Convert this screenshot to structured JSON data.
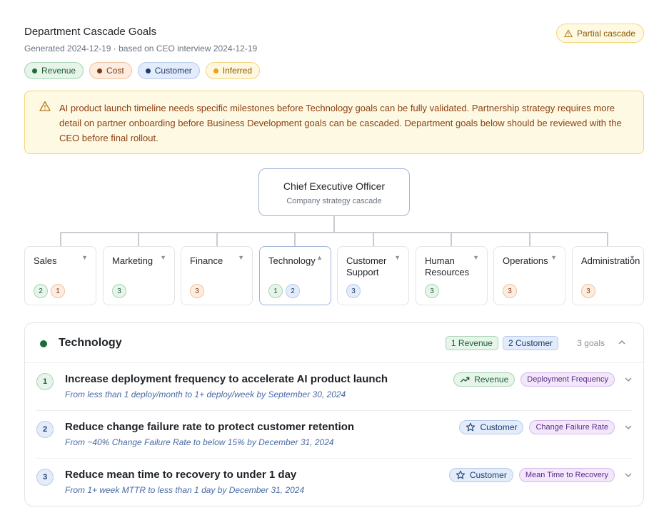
{
  "header": {
    "title": "Department Cascade Goals",
    "subtitle": "Generated 2024-12-19 · based on CEO interview 2024-12-19",
    "status_badge": "Partial cascade"
  },
  "legend": [
    {
      "label": "Revenue",
      "kind": "revenue"
    },
    {
      "label": "Cost",
      "kind": "cost"
    },
    {
      "label": "Customer",
      "kind": "customer"
    },
    {
      "label": "Inferred",
      "kind": "inferred"
    }
  ],
  "alert": {
    "text": "AI product launch timeline needs specific milestones before Technology goals can be fully validated. Partnership strategy requires more detail on partner onboarding before Business Development goals can be cascaded. Department goals below should be reviewed with the CEO before final rollout."
  },
  "ceo": {
    "name": "Chief Executive Officer",
    "desc": "Company strategy cascade"
  },
  "departments": [
    {
      "name": "Sales",
      "caret": "▼",
      "counts": [
        {
          "n": "2",
          "kind": "revenue"
        },
        {
          "n": "1",
          "kind": "cost"
        }
      ]
    },
    {
      "name": "Marketing",
      "caret": "▼",
      "counts": [
        {
          "n": "3",
          "kind": "revenue"
        }
      ]
    },
    {
      "name": "Finance",
      "caret": "▼",
      "counts": [
        {
          "n": "3",
          "kind": "cost"
        }
      ]
    },
    {
      "name": "Technology",
      "caret": "▲",
      "counts": [
        {
          "n": "1",
          "kind": "revenue"
        },
        {
          "n": "2",
          "kind": "customer"
        }
      ]
    },
    {
      "name": "Customer Support",
      "caret": "▼",
      "counts": [
        {
          "n": "3",
          "kind": "customer"
        }
      ]
    },
    {
      "name": "Human Resources",
      "caret": "▼",
      "counts": [
        {
          "n": "3",
          "kind": "revenue"
        }
      ]
    },
    {
      "name": "Operations",
      "caret": "▼",
      "counts": [
        {
          "n": "3",
          "kind": "cost"
        }
      ]
    },
    {
      "name": "Administration",
      "caret": "▼",
      "counts": [
        {
          "n": "3",
          "kind": "cost"
        }
      ]
    }
  ],
  "panel": {
    "title": "Technology",
    "tags": [
      {
        "label": "1 Revenue",
        "kind": "revenue"
      },
      {
        "label": "2 Customer",
        "kind": "customer"
      }
    ],
    "goal_count": "3 goals",
    "goals": [
      {
        "num": "1",
        "kind": "revenue",
        "title": "Increase deployment frequency to accelerate AI product launch",
        "sub": "From less than 1 deploy/month to 1+ deploy/week by September 30, 2024",
        "perspective": "Revenue",
        "icon": "trending-up-icon",
        "metric": "Deployment Frequency"
      },
      {
        "num": "2",
        "kind": "customer",
        "title": "Reduce change failure rate to protect customer retention",
        "sub": "From ~40% Change Failure Rate to below 15% by December 31, 2024",
        "perspective": "Customer",
        "icon": "star-icon",
        "metric": "Change Failure Rate"
      },
      {
        "num": "3",
        "kind": "customer",
        "title": "Reduce mean time to recovery to under 1 day",
        "sub": "From 1+ week MTTR to less than 1 day by December 31, 2024",
        "perspective": "Customer",
        "icon": "star-icon",
        "metric": "Mean Time to Recovery"
      }
    ]
  }
}
